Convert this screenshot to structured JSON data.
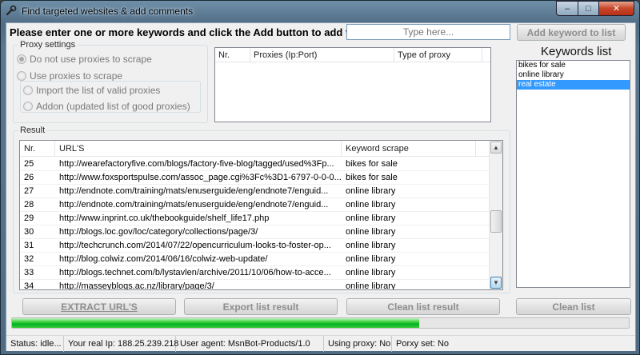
{
  "window": {
    "title": "Find targeted websites & add comments",
    "min_glyph": "–",
    "max_glyph": "□",
    "close_glyph": "✕"
  },
  "keywords_input": {
    "instruction": "Please enter one or more keywords and click the Add button to add them",
    "placeholder": "Type here...",
    "add_button": "Add keyword to list"
  },
  "proxy_settings": {
    "legend": "Proxy settings",
    "options": [
      {
        "label": "Do not use proxies to scrape",
        "checked": true
      },
      {
        "label": "Use proxies to scrape",
        "checked": false
      }
    ],
    "sub_options": [
      {
        "label": "Import the list of valid proxies",
        "checked": false
      },
      {
        "label": "Addon (updated list of good proxies)",
        "checked": false
      }
    ]
  },
  "proxy_table": {
    "columns": [
      "Nr.",
      "Proxies (Ip:Port)",
      "Type of proxy"
    ]
  },
  "keywords_list": {
    "title": "Keywords list",
    "items": [
      "bikes for sale",
      "online library",
      "real estate"
    ],
    "selected_index": 2
  },
  "result": {
    "legend": "Result",
    "columns": [
      "Nr.",
      "URL'S",
      "Keyword scrape"
    ],
    "rows": [
      {
        "nr": "25",
        "url": "http://wearefactoryfive.com/blogs/factory-five-blog/tagged/used%3Fp...",
        "kw": "bikes for sale"
      },
      {
        "nr": "26",
        "url": "http://www.foxsportspulse.com/assoc_page.cgi%3Fc%3D1-6797-0-0-0...",
        "kw": "bikes for sale"
      },
      {
        "nr": "27",
        "url": "http://endnote.com/training/mats/enuserguide/eng/endnote7/enguid...",
        "kw": "online library"
      },
      {
        "nr": "28",
        "url": "http://endnote.com/training/mats/enuserguide/eng/endnote7/enguid...",
        "kw": "online library"
      },
      {
        "nr": "29",
        "url": "http://www.inprint.co.uk/thebookguide/shelf_life17.php",
        "kw": "online library"
      },
      {
        "nr": "30",
        "url": "http://blogs.loc.gov/loc/category/collections/page/3/",
        "kw": "online library"
      },
      {
        "nr": "31",
        "url": "http://techcrunch.com/2014/07/22/opencurriculum-looks-to-foster-op...",
        "kw": "online library"
      },
      {
        "nr": "32",
        "url": "http://blog.colwiz.com/2014/06/16/colwiz-web-update/",
        "kw": "online library"
      },
      {
        "nr": "33",
        "url": "http://blogs.technet.com/b/lystavlen/archive/2011/10/06/how-to-acce...",
        "kw": "online library"
      },
      {
        "nr": "34",
        "url": "http://masseyblogs.ac.nz/library/page/3/",
        "kw": "online library"
      }
    ]
  },
  "buttons": {
    "extract": "EXTRACT URL'S",
    "export": "Export list result",
    "clean_result": "Clean list result",
    "clean_list": "Clean list"
  },
  "progress": {
    "value": 0.66
  },
  "status": {
    "state": "Status: idle...",
    "ip": "Your real Ip: 188.25.239.218",
    "agent": "User agent: MsnBot-Products/1.0",
    "using_proxy": "Using proxy: No",
    "proxy_set": "Porxy set: No"
  },
  "colors": {
    "progress_green": "#06b025",
    "selection_blue": "#3399ff",
    "disabled_text": "#8d8d8d"
  }
}
